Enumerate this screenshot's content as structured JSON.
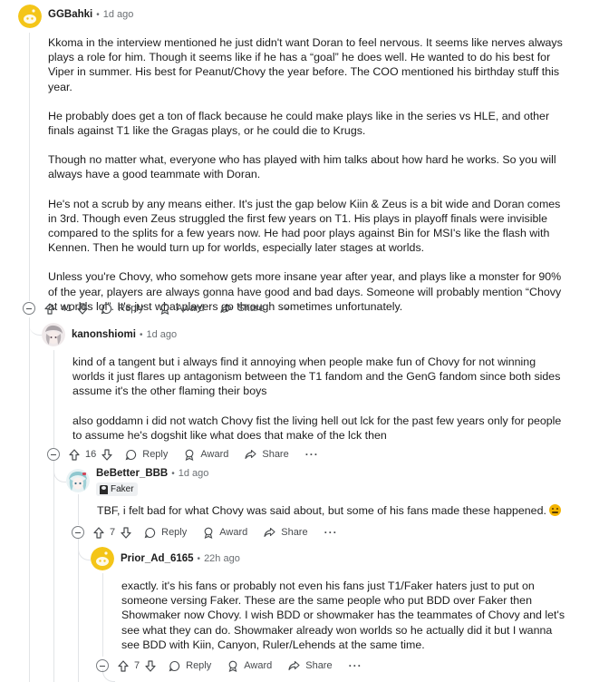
{
  "comments": [
    {
      "username": "GGBahki",
      "time": "1d ago",
      "paragraphs": [
        "Kkoma in the interview mentioned he just didn't want Doran to feel nervous. It seems like nerves always plays a role for him. Though it seems like if he has a “goal” he does well. He wanted to do his best for Viper in summer. His best for Peanut/Chovy the year before. The COO mentioned his birthday stuff this year.",
        "He probably does get a ton of flack because he could make plays like in the series vs HLE, and other finals against T1 like the Gragas plays, or he could die to Krugs.",
        "Though no matter what, everyone who has played with him talks about how hard he works. So you will always have a good teammate with Doran.",
        "He's not a scrub by any means either. It's just the gap below Kiin & Zeus is a bit wide and Doran comes in 3rd. Though even Zeus struggled the first few years on T1. His plays in playoff finals were invisible compared to the splits for a few years now. He had poor plays against Bin for MSI's like the flash with Kennen. Then he would turn up for worlds, especially later stages at worlds.",
        "Unless you're Chovy, who somehow gets more insane year after year, and plays like a monster for 90% of the year, players are always gonna have good and bad days. Someone will probably mention “Chovy at worlds lol”. It's just what players go through sometimes unfortunately."
      ],
      "votes": "41"
    },
    {
      "username": "kanonshiomi",
      "time": "1d ago",
      "paragraphs": [
        "kind of a tangent but i always find it annoying when people make fun of Chovy for not winning worlds it just flares up antagonism between the T1 fandom and the GenG fandom since both sides assume it's the other flaming their boys",
        "also goddamn i did not watch Chovy fist the living hell out lck for the past few years only for people to assume he's dogshit like what does that make of the lck then"
      ],
      "votes": "16"
    },
    {
      "username": "BeBetter_BBB",
      "time": "1d ago",
      "flair": "Faker",
      "paragraphs": [
        "TBF, i felt bad for what Chovy was said about, but some of his fans made these happened."
      ],
      "votes": "7"
    },
    {
      "username": "Prior_Ad_6165",
      "time": "22h ago",
      "paragraphs": [
        "exactly. it's his fans or probably not even his fans just T1/Faker haters just to put on someone versing Faker. These are the same people who put BDD over Faker then Showmaker now Chovy. I wish BDD or showmaker has the teammates of Chovy and let's see what they can do. Showmaker already won worlds so he actually did it but I wanna see BDD with Kiin, Canyon, Ruler/Lehends at the same time."
      ],
      "votes": "7"
    }
  ],
  "actions": {
    "reply": "Reply",
    "award": "Award",
    "share": "Share",
    "more": "···"
  },
  "icons": {
    "upvote": "upvote-arrow-icon",
    "downvote": "downvote-arrow-icon",
    "reply": "speech-bubble-icon",
    "award": "award-ribbon-icon",
    "share": "share-arrow-icon",
    "collapse": "collapse-minus-icon",
    "emoji": "grimacing-face-emoji"
  },
  "colors": {
    "snoo_yellow": "#f4c518",
    "text": "#1c1c1c",
    "meta": "#6b6f73",
    "thread": "#e2e4e7"
  }
}
